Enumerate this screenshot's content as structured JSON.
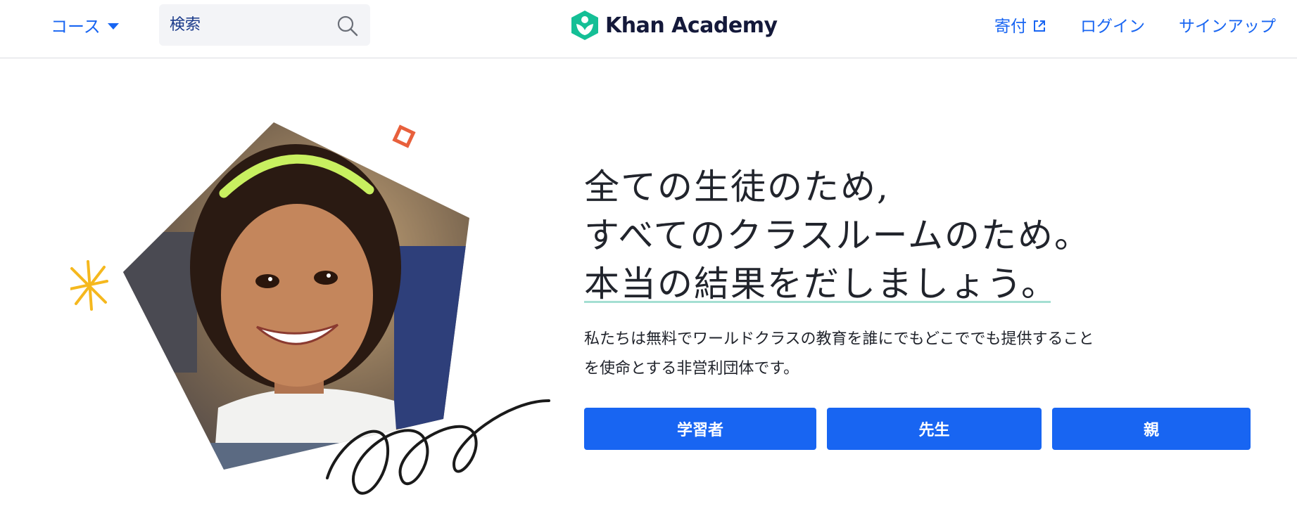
{
  "header": {
    "courses_label": "コース",
    "search": {
      "value": "",
      "placeholder": "検索"
    },
    "logo_text": "Khan Academy",
    "nav": {
      "donate_label": "寄付",
      "login_label": "ログイン",
      "signup_label": "サインアップ"
    }
  },
  "hero": {
    "headline_lines": [
      "全ての生徒のため,",
      "すべてのクラスルームのため。",
      "本当の結果をだしましょう。"
    ],
    "mission_lines": [
      "私たちは無料でワールドクラスの教育を誰にでもどこででも提供すること",
      "を使命とする非営利団体です。"
    ],
    "buttons": {
      "learner": "学習者",
      "teacher": "先生",
      "parent": "親"
    }
  },
  "colors": {
    "accent": "#1865f2",
    "brand_green": "#14bf96",
    "logo_text": "#14193a",
    "headline_underline": "#a4dfd2",
    "shape_orange": "#e8603c",
    "shape_yellow": "#f5b81e"
  },
  "icons": {
    "courses_caret": "caret-down-icon",
    "search": "search-icon",
    "logo": "khan-academy-leaf-icon",
    "donate_external": "external-link-icon"
  }
}
